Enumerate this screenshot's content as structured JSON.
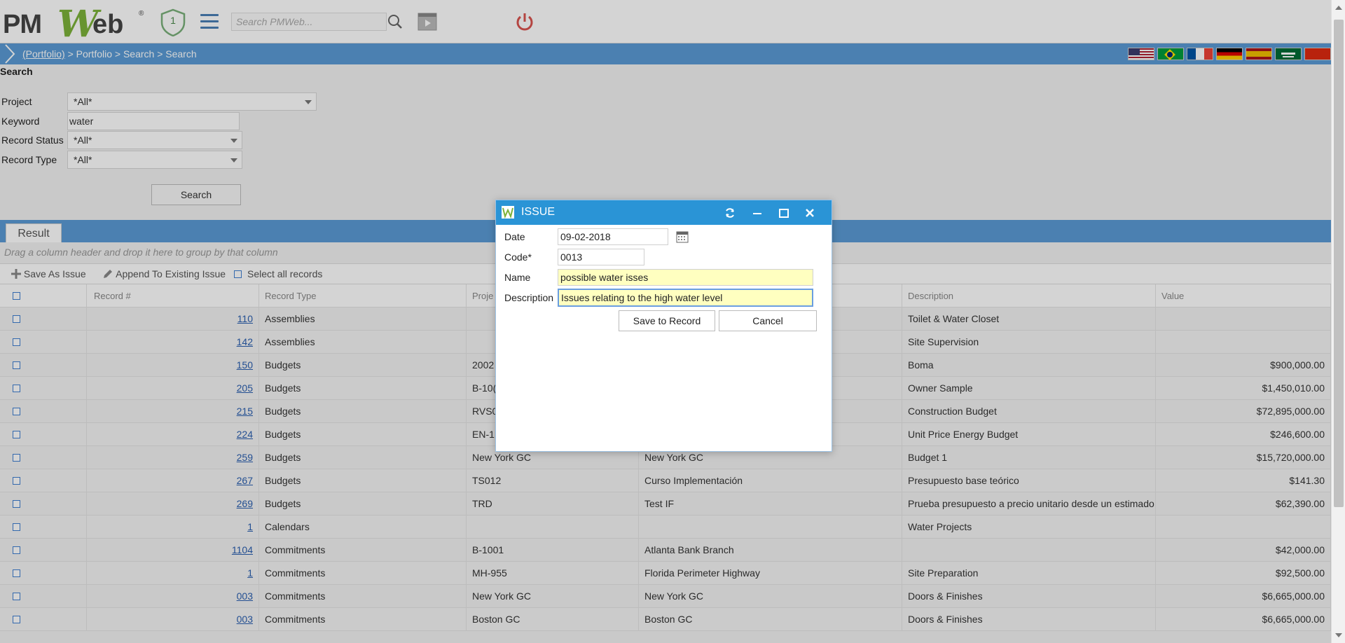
{
  "header": {
    "logo": {
      "pm": "PM",
      "w": "W",
      "eb": "eb",
      "reg": "®"
    },
    "shield_count": "1",
    "search_placeholder": "Search PMWeb..."
  },
  "breadcrumb": {
    "link": "(Portfolio)",
    "path": " > Portfolio > Search > Search"
  },
  "search_form": {
    "title": "Search",
    "fields": {
      "project_label": "Project",
      "project_value": "*All*",
      "keyword_label": "Keyword",
      "keyword_value": "water",
      "status_label": "Record Status",
      "status_value": "*All*",
      "type_label": "Record Type",
      "type_value": "*All*"
    },
    "search_button": "Search"
  },
  "results": {
    "tab": "Result",
    "group_hint": "Drag a column header and drop it here to group by that column",
    "toolbar": {
      "save_as_issue": "Save As Issue",
      "append": "Append To Existing Issue",
      "select_all": "Select all records"
    },
    "columns": {
      "record": "Record #",
      "type": "Record Type",
      "project": "Proje",
      "description": "Description",
      "value": "Value"
    },
    "rows": [
      {
        "record": "110",
        "type": "Assemblies",
        "project": "",
        "project_name": "",
        "description": "Toilet & Water Closet",
        "value": ""
      },
      {
        "record": "142",
        "type": "Assemblies",
        "project": "",
        "project_name": "",
        "description": "Site Supervision",
        "value": ""
      },
      {
        "record": "150",
        "type": "Budgets",
        "project": "2002",
        "project_name": "",
        "description": "Boma",
        "value": "$900,000.00"
      },
      {
        "record": "205",
        "type": "Budgets",
        "project": "B-10(",
        "project_name": "",
        "description": "Owner Sample",
        "value": "$1,450,010.00"
      },
      {
        "record": "215",
        "type": "Budgets",
        "project": "RVS0",
        "project_name": "",
        "description": "Construction Budget",
        "value": "$72,895,000.00"
      },
      {
        "record": "224",
        "type": "Budgets",
        "project": "EN-1",
        "project_name": "",
        "description": "Unit Price Energy Budget",
        "value": "$246,600.00"
      },
      {
        "record": "259",
        "type": "Budgets",
        "project": "New York GC",
        "project_name": "New York GC",
        "description": "Budget 1",
        "value": "$15,720,000.00"
      },
      {
        "record": "267",
        "type": "Budgets",
        "project": "TS012",
        "project_name": "Curso Implementación",
        "description": "Presupuesto base teórico",
        "value": "$141.30"
      },
      {
        "record": "269",
        "type": "Budgets",
        "project": "TRD",
        "project_name": "Test IF",
        "description": "Prueba presupuesto a precio unitario desde un estimado",
        "value": "$62,390.00"
      },
      {
        "record": "1",
        "type": "Calendars",
        "project": "",
        "project_name": "",
        "description": "Water Projects",
        "value": ""
      },
      {
        "record": "1104",
        "type": "Commitments",
        "project": "B-1001",
        "project_name": "Atlanta Bank Branch",
        "description": "",
        "value": "$42,000.00"
      },
      {
        "record": "1",
        "type": "Commitments",
        "project": "MH-955",
        "project_name": "Florida Perimeter Highway",
        "description": "Site Preparation",
        "value": "$92,500.00"
      },
      {
        "record": "003",
        "type": "Commitments",
        "project": "New York GC",
        "project_name": "New York GC",
        "description": "Doors & Finishes",
        "value": "$6,665,000.00"
      },
      {
        "record": "003",
        "type": "Commitments",
        "project": "Boston GC",
        "project_name": "Boston GC",
        "description": "Doors & Finishes",
        "value": "$6,665,000.00"
      }
    ]
  },
  "dialog": {
    "title": "ISSUE",
    "date_label": "Date",
    "date_value": "09-02-2018",
    "code_label": "Code*",
    "code_value": "0013",
    "name_label": "Name",
    "name_value": "possible water isses",
    "description_label": "Description",
    "description_value": "Issues relating to the high water level",
    "save_button": "Save to Record",
    "cancel_button": "Cancel"
  },
  "colors": {
    "accent_blue": "#5b9bd5",
    "dialog_title": "#2a94d6",
    "logo_green": "#7cb23a",
    "power_red": "#d9534f",
    "highlight_yellow": "#ffffc0"
  }
}
